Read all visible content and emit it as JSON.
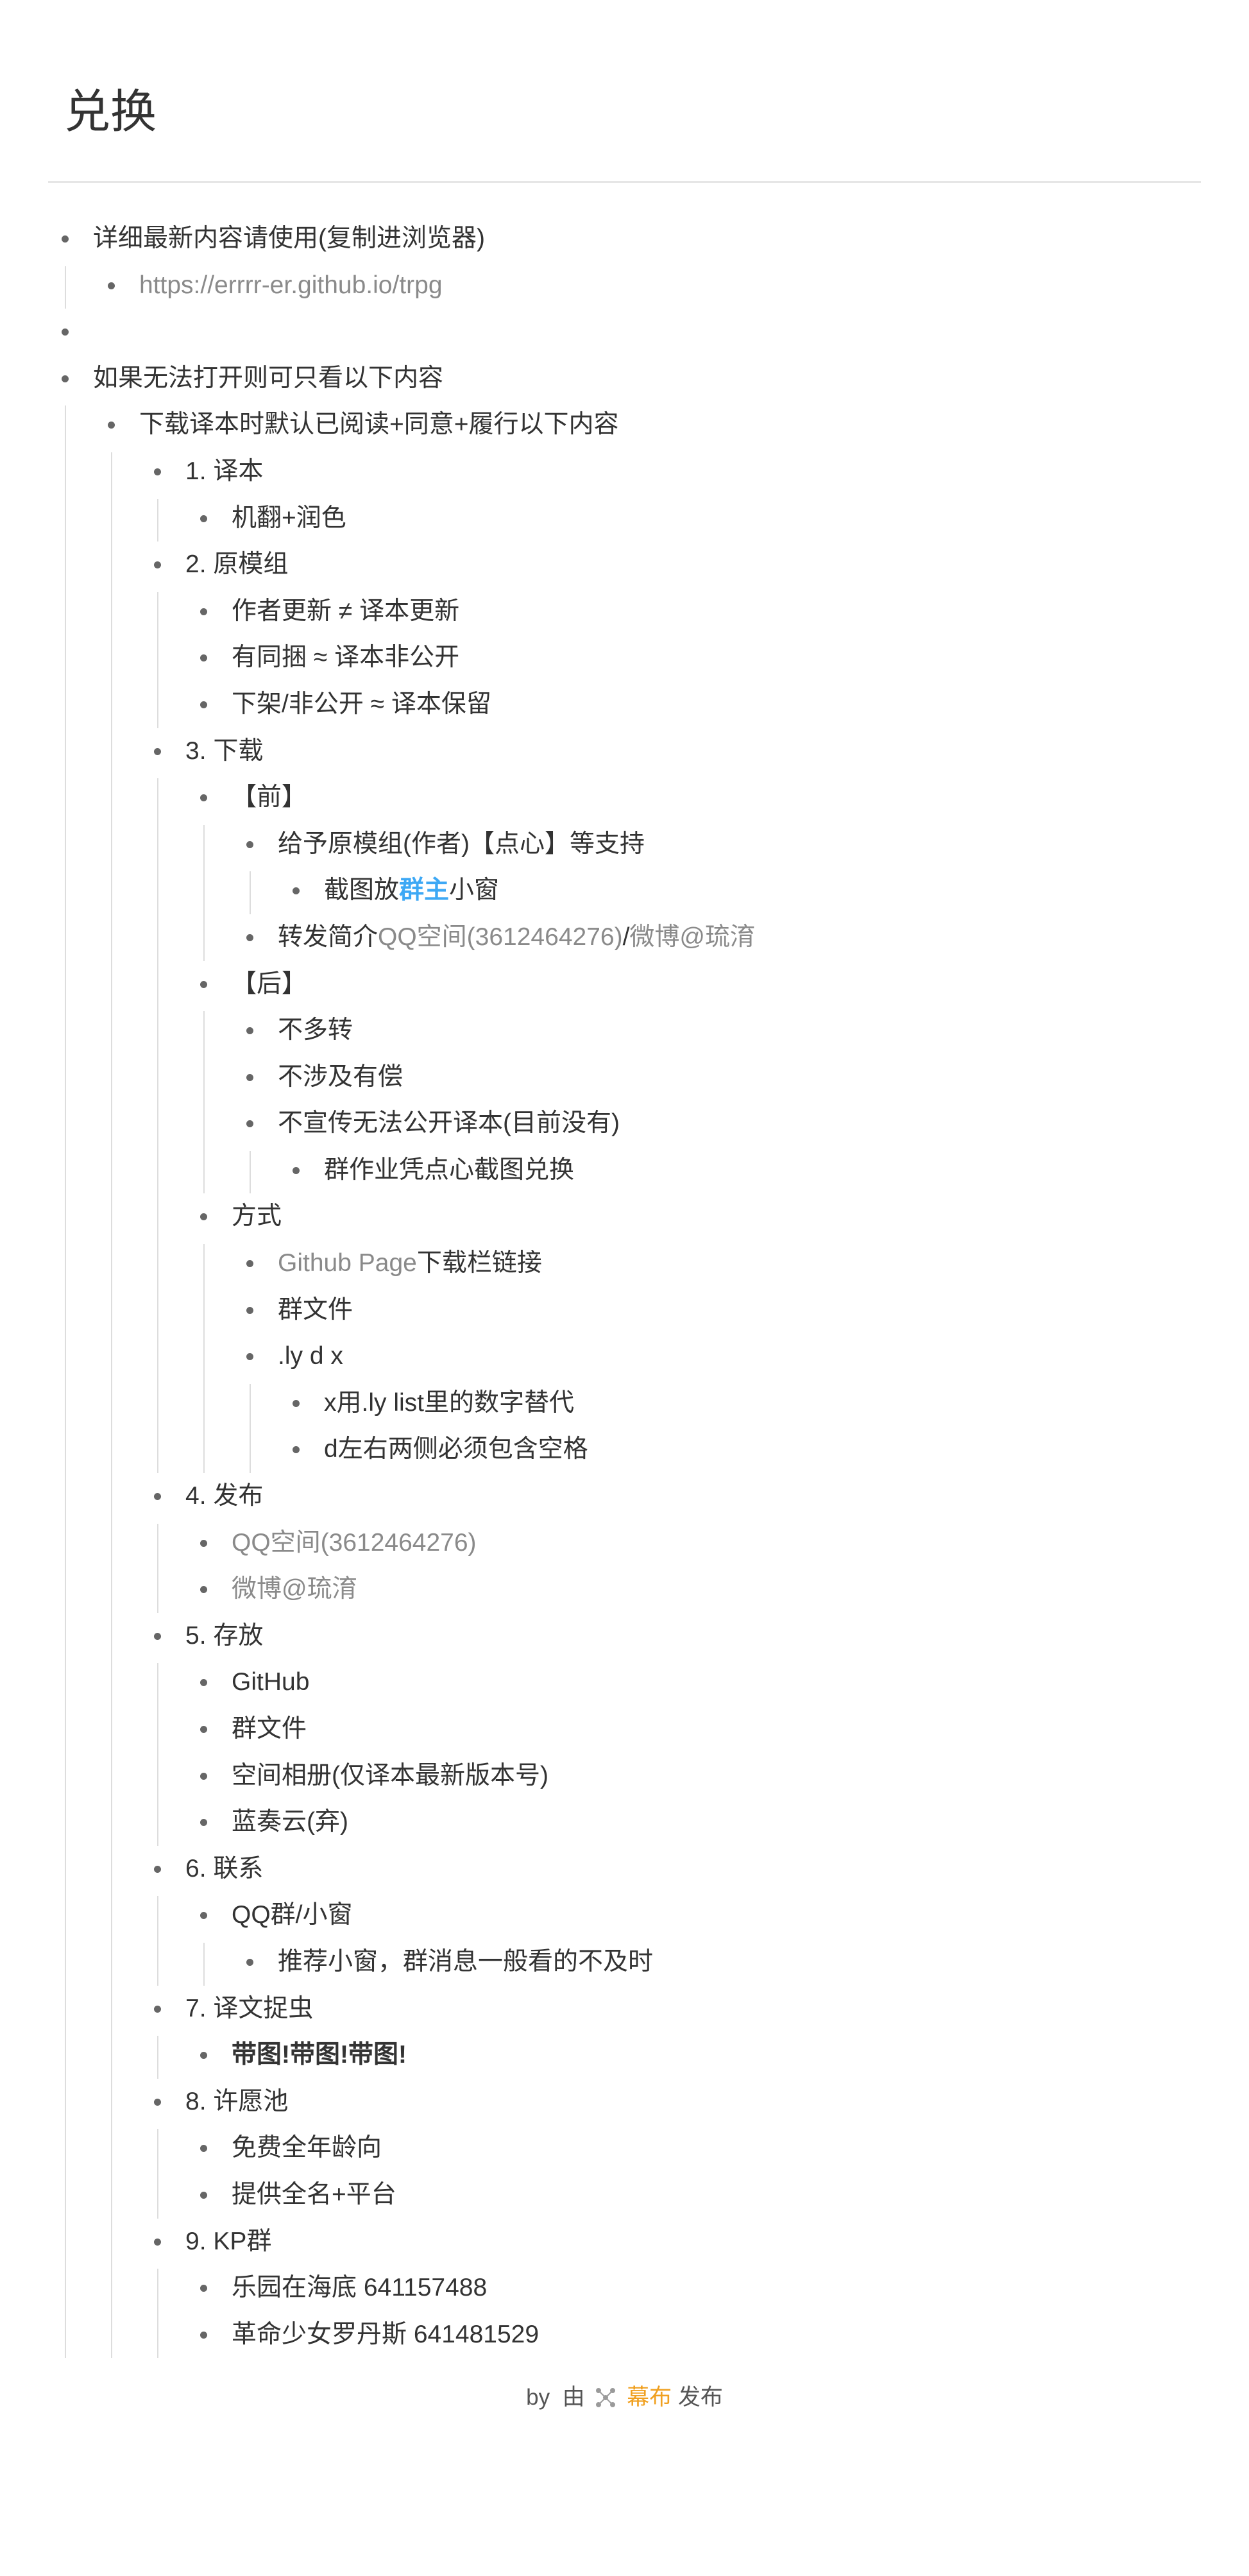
{
  "title": "兑换",
  "outline": [
    {
      "text": "详细最新内容请使用(复制进浏览器)",
      "children": [
        {
          "parts": [
            {
              "text": "https://errrr-er.github.io/trpg",
              "style": "link"
            }
          ]
        }
      ]
    },
    {
      "text": ""
    },
    {
      "text": "如果无法打开则可只看以下内容",
      "children": [
        {
          "text": "下载译本时默认已阅读+同意+履行以下内容",
          "children": [
            {
              "text": "1. 译本",
              "children": [
                {
                  "text": "机翻+润色"
                }
              ]
            },
            {
              "text": "2. 原模组",
              "children": [
                {
                  "text": "作者更新 ≠ 译本更新"
                },
                {
                  "text": "有同捆 ≈ 译本非公开"
                },
                {
                  "text": "下架/非公开 ≈ 译本保留"
                }
              ]
            },
            {
              "text": "3. 下载",
              "children": [
                {
                  "text": "【前】",
                  "children": [
                    {
                      "text": "给予原模组(作者)【点心】等支持",
                      "children": [
                        {
                          "parts": [
                            {
                              "text": "截图放"
                            },
                            {
                              "text": "群主",
                              "style": "strong-blue"
                            },
                            {
                              "text": "小窗"
                            }
                          ]
                        }
                      ]
                    },
                    {
                      "parts": [
                        {
                          "text": "转发简介"
                        },
                        {
                          "text": "QQ空间(3612464276)",
                          "style": "link"
                        },
                        {
                          "text": "/"
                        },
                        {
                          "text": "微博@琉淯",
                          "style": "link"
                        }
                      ]
                    }
                  ]
                },
                {
                  "text": "【后】",
                  "children": [
                    {
                      "text": "不多转"
                    },
                    {
                      "text": "不涉及有偿"
                    },
                    {
                      "text": "不宣传无法公开译本(目前没有)",
                      "children": [
                        {
                          "text": "群作业凭点心截图兑换"
                        }
                      ]
                    }
                  ]
                },
                {
                  "text": "方式",
                  "children": [
                    {
                      "parts": [
                        {
                          "text": "Github Page",
                          "style": "link"
                        },
                        {
                          "text": "下载栏链接"
                        }
                      ]
                    },
                    {
                      "text": "群文件"
                    },
                    {
                      "text": ".ly d x",
                      "children": [
                        {
                          "text": "x用.ly list里的数字替代"
                        },
                        {
                          "text": "d左右两侧必须包含空格"
                        }
                      ]
                    }
                  ]
                }
              ]
            },
            {
              "text": "4. 发布",
              "children": [
                {
                  "parts": [
                    {
                      "text": "QQ空间(3612464276)",
                      "style": "link"
                    }
                  ]
                },
                {
                  "parts": [
                    {
                      "text": "微博@琉淯",
                      "style": "link"
                    }
                  ]
                }
              ]
            },
            {
              "text": "5. 存放",
              "children": [
                {
                  "text": "GitHub"
                },
                {
                  "text": "群文件"
                },
                {
                  "text": "空间相册(仅译本最新版本号)"
                },
                {
                  "text": "蓝奏云(弃)"
                }
              ]
            },
            {
              "text": "6. 联系",
              "children": [
                {
                  "text": "QQ群/小窗",
                  "children": [
                    {
                      "text": "推荐小窗，群消息一般看的不及时"
                    }
                  ]
                }
              ]
            },
            {
              "text": "7. 译文捉虫",
              "children": [
                {
                  "parts": [
                    {
                      "text": "带图!带图!带图!",
                      "style": "strong"
                    }
                  ]
                }
              ]
            },
            {
              "text": "8. 许愿池",
              "children": [
                {
                  "text": "免费全年龄向"
                },
                {
                  "text": "提供全名+平台"
                }
              ]
            },
            {
              "text": "9. KP群",
              "children": [
                {
                  "text": "乐园在海底 641157488"
                },
                {
                  "text": "革命少女罗丹斯 641481529"
                }
              ]
            }
          ]
        }
      ]
    }
  ],
  "footer": {
    "by": "by",
    "prefix": "由",
    "brand": "幕布",
    "suffix": "发布",
    "logo_icon": "mubu-logo-icon"
  }
}
